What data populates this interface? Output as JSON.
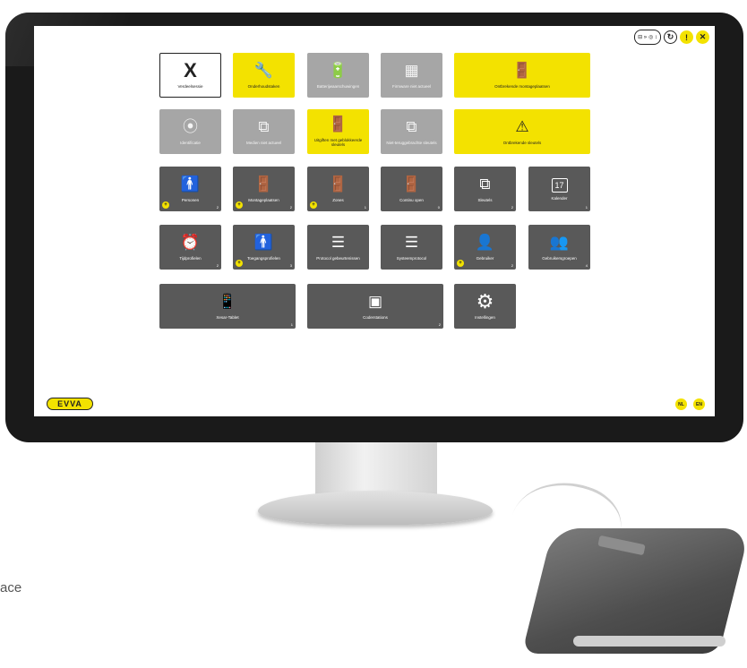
{
  "caption": "ace",
  "topbar": {
    "status_left": "⊟ »",
    "status_right": "◎ ↕",
    "sync_icon": "↻",
    "user_icon": "!",
    "close_icon": "✕"
  },
  "tiles": [
    {
      "id": "tile-1",
      "icon": "X",
      "label": "Verdeelsessie",
      "count": ""
    },
    {
      "id": "tile-2",
      "icon": "🔧",
      "label": "Onderhoudstaken",
      "count": ""
    },
    {
      "id": "tile-3",
      "icon": "🔋",
      "label": "Batterijwaarschuwingen",
      "count": ""
    },
    {
      "id": "tile-4",
      "icon": "▦",
      "label": "Firmware niet actueel",
      "count": ""
    },
    {
      "id": "tile-5",
      "icon": "🚪",
      "label": "Ontbrekende montageplaatsen",
      "count": ""
    },
    {
      "id": "tile-6",
      "icon": "⦿",
      "label": "Identificatie",
      "count": ""
    },
    {
      "id": "tile-7",
      "icon": "⧉",
      "label": "Medien niet actueel",
      "count": ""
    },
    {
      "id": "tile-8",
      "icon": "🚪",
      "label": "Uitgiften met geblokkeerde sleutels",
      "count": ""
    },
    {
      "id": "tile-9",
      "icon": "⧉",
      "label": "Niet-teruggebrachte sleutels",
      "count": ""
    },
    {
      "id": "tile-10",
      "icon": "⚠",
      "label": "Ontbrekende sleutels",
      "count": ""
    },
    {
      "id": "tile-11",
      "icon": "🚹",
      "label": "Personen",
      "count": "2"
    },
    {
      "id": "tile-12",
      "icon": "🚪",
      "label": "Montageplaatsen",
      "count": "2"
    },
    {
      "id": "tile-13",
      "icon": "🚪",
      "label": "Zones",
      "count": "1"
    },
    {
      "id": "tile-14",
      "icon": "🚪",
      "label": "Continu open",
      "count": "0"
    },
    {
      "id": "tile-15",
      "icon": "⧉",
      "label": "Sleutels",
      "count": "2"
    },
    {
      "id": "tile-16",
      "icon": "17",
      "label": "Kalender",
      "count": "1"
    },
    {
      "id": "tile-17",
      "icon": "⏰",
      "label": "Tijdprofielen",
      "count": "2"
    },
    {
      "id": "tile-18",
      "icon": "🚹",
      "label": "Toegangsprofielen",
      "count": "3"
    },
    {
      "id": "tile-19",
      "icon": "☰",
      "label": "Protocol gebeurtenissen",
      "count": ""
    },
    {
      "id": "tile-20",
      "icon": "☰",
      "label": "Systeemprotocol",
      "count": ""
    },
    {
      "id": "tile-21",
      "icon": "👤",
      "label": "Gebruiker",
      "count": "2"
    },
    {
      "id": "tile-22",
      "icon": "👥",
      "label": "Gebruikersgroepen",
      "count": "4"
    },
    {
      "id": "tile-23",
      "icon": "📱",
      "label": "Xesar-Tablet",
      "count": "1"
    },
    {
      "id": "tile-24",
      "icon": "▣",
      "label": "Coderstations",
      "count": "2"
    },
    {
      "id": "tile-25",
      "icon": "⚙",
      "label": "Instellingen",
      "count": ""
    }
  ],
  "footer": {
    "logo": "EVVA",
    "lang_nl": "NL",
    "lang_en": "EN"
  }
}
